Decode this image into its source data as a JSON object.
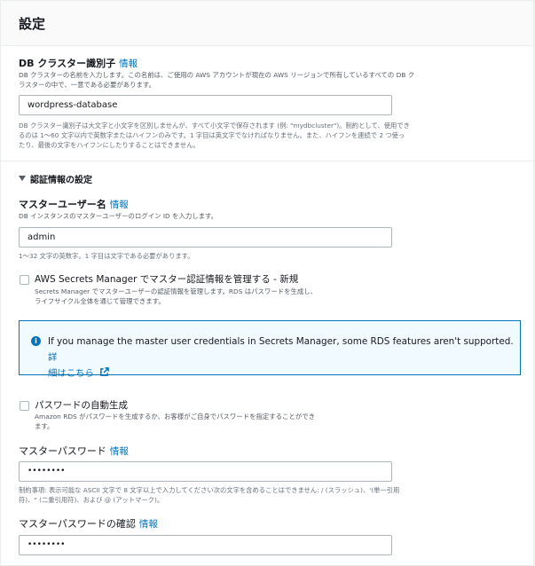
{
  "section": {
    "title": "設定"
  },
  "cluster_id": {
    "label": "DB クラスター識別子",
    "info": "情報",
    "description_line1": "DB クラスターの名前を入力します。この名前は、ご使用の AWS アカウントが現在の AWS リージョンで所有しているすべての DB ク",
    "description_line2": "ラスターの中で、一意である必要があります。",
    "value": "wordpress-database",
    "constraint_line1": "DB クラスター識別子は大文字と小文字を区別しませんが、すべて小文字で保存されます (例: \"mydbcluster\")。制約として、使用でき",
    "constraint_line2": "るのは 1～60 文字以内で英数字またはハイフンのみです。1 字目は英文字でなければなりません。また、ハイフンを連続で 2 つ使っ",
    "constraint_line3": "たり、最後の文字をハイフンにしたりすることはできません。"
  },
  "credentials": {
    "title": "認証情報の設定",
    "master_username": {
      "label": "マスターユーザー名",
      "info": "情報",
      "description": "DB インスタンスのマスターユーザーのログイン ID を入力します。",
      "value": "admin",
      "constraint": "1～32 文字の英数字。1 字目は文字である必要があります。"
    },
    "secrets_manager": {
      "label": "AWS Secrets Manager でマスター認証情報を管理する - 新規",
      "description_line1": "Secrets Manager でマスターユーザーの認証情報を管理します。RDS はパスワードを生成し、",
      "description_line2": "ライフサイクル全体を通じて管理できます。"
    },
    "alert": {
      "text": "If you manage the master user credentials in Secrets Manager, some RDS features aren't supported.",
      "link_part1": "詳",
      "link_part2": "細はこちら",
      "icon": "info-circle-icon"
    },
    "auto_generate": {
      "label": "パスワードの自動生成",
      "description_line1": "Amazon RDS がパスワードを生成するか、お客様がご自身でパスワードを指定することができ",
      "description_line2": "ます。"
    },
    "master_password": {
      "label": "マスターパスワード",
      "info": "情報",
      "value": "••••••••",
      "constraint_line1": "制約事項: 表示可能な ASCII 文字で 8 文字以上で入力してください次の文字を含めることはできません: / (スラッシュ)、'(単一引用",
      "constraint_line2": "符)、\" (二重引用符)、および @ (アットマーク)。"
    },
    "confirm_password": {
      "label": "マスターパスワードの確認",
      "info": "情報",
      "value": "••••••••"
    }
  },
  "colors": {
    "link": "#0073bb",
    "border": "#aab7b8",
    "text": "#16191f"
  }
}
